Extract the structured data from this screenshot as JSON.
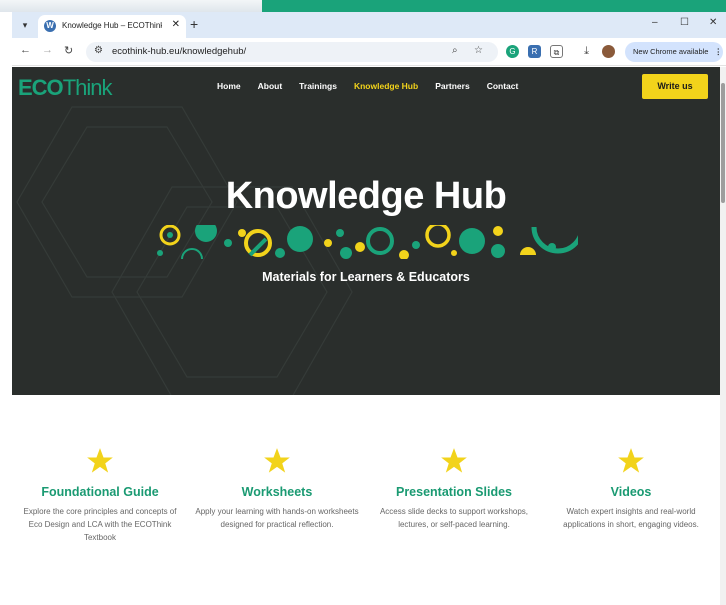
{
  "browser": {
    "tab": {
      "title": "Knowledge Hub – ECOThink Hu",
      "favicon": "wordpress-icon"
    },
    "url": "ecothink-hub.eu/knowledgehub/",
    "update_label": "New Chrome available",
    "window_controls": {
      "minimize": "–",
      "maximize": "☐",
      "close": "✕"
    },
    "new_tab": "+",
    "tab_close": "✕"
  },
  "site": {
    "logo": {
      "eco": "ECO",
      "think": "Think"
    },
    "nav": [
      {
        "label": "Home"
      },
      {
        "label": "About"
      },
      {
        "label": "Trainings"
      },
      {
        "label": "Knowledge Hub"
      },
      {
        "label": "Partners"
      },
      {
        "label": "Contact"
      }
    ],
    "cta": "Write us",
    "hero": {
      "title": "Knowledge Hub",
      "subtitle": "Materials for Learners & Educators"
    },
    "cards": [
      {
        "title": "Foundational Guide",
        "description": "Explore the core principles and concepts of Eco Design and LCA with the ECOThink Textbook",
        "icon": "star-icon"
      },
      {
        "title": "Worksheets",
        "description": "Apply your learning with hands-on worksheets designed for practical reflection.",
        "icon": "star-icon"
      },
      {
        "title": "Presentation Slides",
        "description": "Access slide decks to support workshops, lectures, or self-paced learning.",
        "icon": "star-icon"
      },
      {
        "title": "Videos",
        "description": "Watch expert insights and real-world applications in short, engaging videos.",
        "icon": "star-icon"
      }
    ]
  },
  "colors": {
    "brand_green": "#1aa37a",
    "accent_yellow": "#f2d31b",
    "hero_bg": "#2a2e2c"
  }
}
